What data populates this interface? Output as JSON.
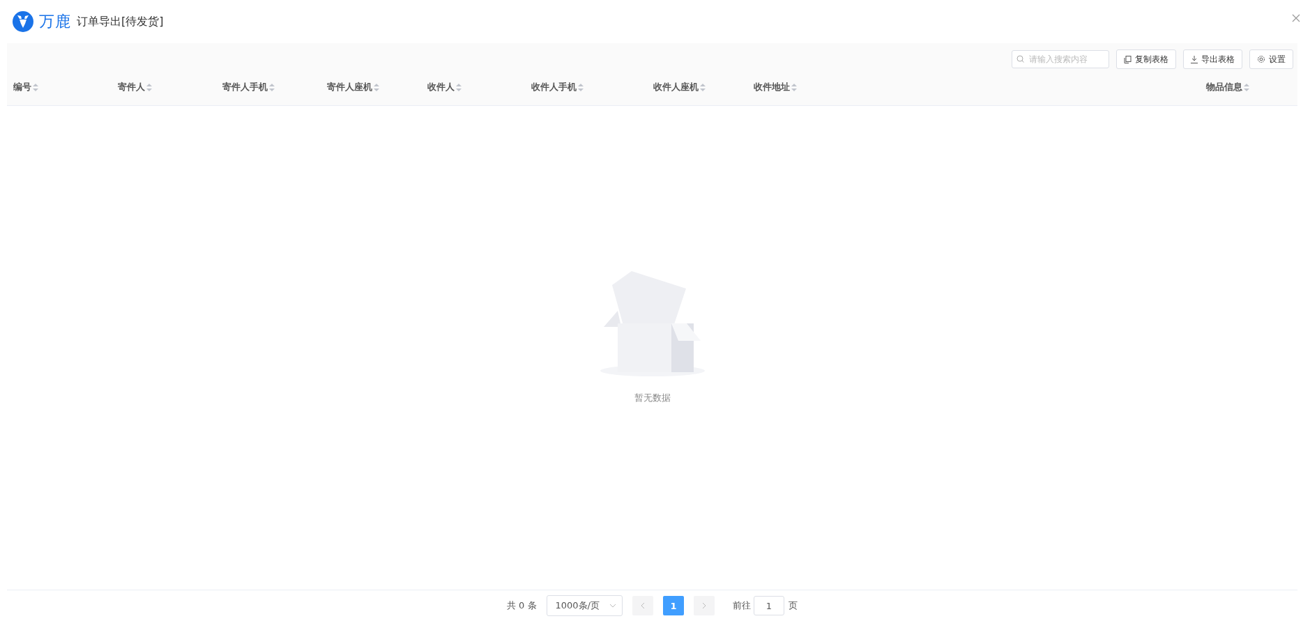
{
  "header": {
    "logo_text": "万鹿",
    "title": "订单导出[待发货]"
  },
  "toolbar": {
    "search": {
      "placeholder": "请输入搜索内容"
    },
    "buttons": [
      {
        "kind": "copy",
        "label": "复制表格"
      },
      {
        "kind": "export",
        "label": "导出表格"
      },
      {
        "kind": "settings",
        "label": "设置"
      }
    ]
  },
  "table": {
    "columns": [
      "编号",
      "寄件人",
      "寄件人手机",
      "寄件人座机",
      "收件人",
      "收件人手机",
      "收件人座机",
      "收件地址",
      "物品信息"
    ],
    "empty_text": "暂无数据"
  },
  "pagination": {
    "total": "共 0 条",
    "page_size": "1000条/页",
    "pages": [
      {
        "label": "1",
        "selected": true
      }
    ],
    "goto_label": "前往",
    "goto_value": "1",
    "goto_suffix": "页"
  }
}
